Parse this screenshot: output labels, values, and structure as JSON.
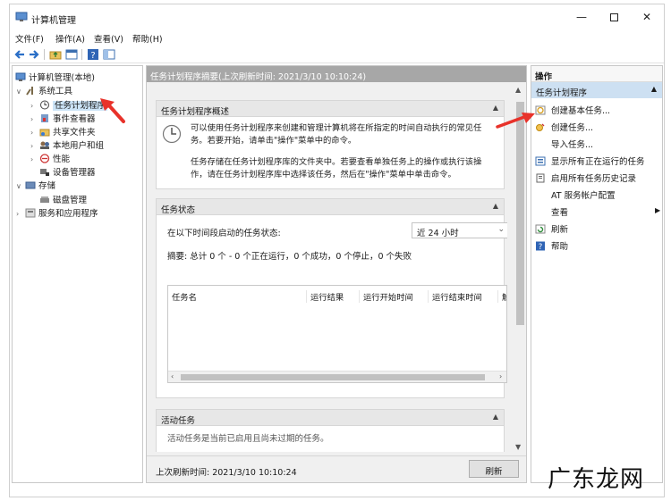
{
  "window": {
    "title": "计算机管理",
    "controls": {
      "minimize": "—",
      "close": "✕"
    }
  },
  "menubar": {
    "items": [
      "文件(F)",
      "操作(A)",
      "查看(V)",
      "帮助(H)"
    ]
  },
  "toolbar": {
    "buttons": [
      "back-icon",
      "forward-icon",
      "folder-up-icon",
      "properties-icon",
      "help-icon",
      "show-hide-icon"
    ]
  },
  "tree": {
    "items": [
      {
        "label": "计算机管理(本地)",
        "arrow": "",
        "icon": "computer-icon"
      },
      {
        "label": "系统工具",
        "arrow": "∨",
        "icon": "tools-icon"
      },
      {
        "label": "任务计划程序",
        "arrow": "›",
        "icon": "clock-icon",
        "selected": true
      },
      {
        "label": "事件查看器",
        "arrow": "›",
        "icon": "event-viewer-icon"
      },
      {
        "label": "共享文件夹",
        "arrow": "›",
        "icon": "shared-folder-icon"
      },
      {
        "label": "本地用户和组",
        "arrow": "›",
        "icon": "users-icon"
      },
      {
        "label": "性能",
        "arrow": "›",
        "icon": "performance-icon"
      },
      {
        "label": "设备管理器",
        "arrow": "",
        "icon": "device-manager-icon"
      },
      {
        "label": "存储",
        "arrow": "∨",
        "icon": "storage-icon"
      },
      {
        "label": "磁盘管理",
        "arrow": "",
        "icon": "disk-icon"
      },
      {
        "label": "服务和应用程序",
        "arrow": "›",
        "icon": "services-icon"
      }
    ]
  },
  "center": {
    "header": "任务计划程序摘要(上次刷新时间: 2021/3/10 10:10:24)",
    "overview": {
      "title": "任务计划程序概述",
      "para1_line1": "可以使用任务计划程序来创建和管理计算机将在所指定的时间自动执行的常见任",
      "para1_line2": "务。若要开始，请单击\"操作\"菜单中的命令。",
      "para2_line1": "任务存储在任务计划程序库的文件夹中。若要查看单独任务上的操作或执行该操",
      "para2_line2": "作，请在任务计划程序库中选择该任务，然后在\"操作\"菜单中单击命令。"
    },
    "status": {
      "title": "任务状态",
      "period_label": "在以下时间段启动的任务状态:",
      "period_value": "近 24 小时",
      "summary": "摘要: 总计 0 个 - 0 个正在运行，0 个成功，0 个停止，0 个失败",
      "columns": [
        "任务名",
        "运行结果",
        "运行开始时间",
        "运行结束时间",
        "触"
      ]
    },
    "active": {
      "title": "活动任务",
      "partial_text": "活动任务是当前已启用且尚未过期的任务。"
    },
    "footer": {
      "last_refresh": "上次刷新时间: 2021/3/10 10:10:24",
      "refresh_button": "刷新"
    }
  },
  "actions": {
    "header": "操作",
    "group": "任务计划程序",
    "items": [
      {
        "label": "创建基本任务...",
        "icon": "create-basic-task-icon"
      },
      {
        "label": "创建任务...",
        "icon": "create-task-icon"
      },
      {
        "label": "导入任务...",
        "icon": ""
      },
      {
        "label": "显示所有正在运行的任务",
        "icon": "running-tasks-icon"
      },
      {
        "label": "启用所有任务历史记录",
        "icon": "history-icon"
      },
      {
        "label": "AT 服务帐户配置",
        "icon": ""
      },
      {
        "label": "查看",
        "icon": "",
        "submenu": true
      },
      {
        "label": "刷新",
        "icon": "refresh-icon"
      },
      {
        "label": "帮助",
        "icon": "help-icon"
      }
    ]
  },
  "watermark": "广东龙网",
  "colors": {
    "selection": "#cce4f7",
    "header_gray": "#a7a7a7",
    "actions_group": "#cde0f2",
    "annotation_red": "#e8322a"
  }
}
